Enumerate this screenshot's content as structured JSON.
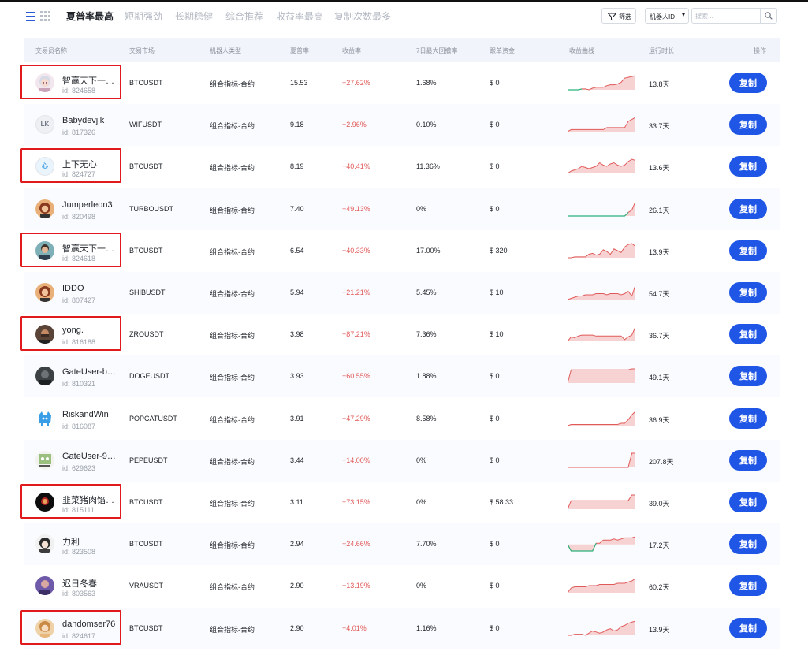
{
  "tabs": [
    {
      "label": "夏普率最高",
      "active": true
    },
    {
      "label": "短期强劲",
      "active": false
    },
    {
      "label": "长期稳健",
      "active": false
    },
    {
      "label": "综合推荐",
      "active": false
    },
    {
      "label": "收益率最高",
      "active": false
    },
    {
      "label": "复制次数最多",
      "active": false
    }
  ],
  "toolbar": {
    "filter_label": "筛选",
    "id_select_label": "机器人ID",
    "search_placeholder": "搜索..."
  },
  "table": {
    "headers": {
      "trader": "交易员名称",
      "market": "交易市场",
      "robot_type": "机器人类型",
      "sharpe": "夏普率",
      "return": "收益率",
      "max_drawdown": "7日最大回撤率",
      "followers_fund": "跟单资金",
      "curve": "收益曲线",
      "runtime": "运行时长",
      "action": "操作"
    },
    "copy_label": "复制",
    "rows": [
      {
        "name": "智赢天下一…",
        "id": "id: 824658",
        "market": "BTCUSDT",
        "robot_type": "组合指标-合约",
        "sharpe": "15.53",
        "return": "+27.62%",
        "drawdown": "1.68%",
        "fund": "$ 0",
        "runtime": "13.8天",
        "curve": [
          0,
          0,
          0,
          0,
          1,
          1,
          0,
          2,
          3,
          3,
          3,
          5,
          6,
          6,
          7,
          9,
          14,
          15,
          16,
          17
        ],
        "curve_start_color": "#2bb37b",
        "avatar": "anime",
        "highlighted": true
      },
      {
        "name": "Babydevjlk",
        "id": "id: 817326",
        "market": "WIFUSDT",
        "robot_type": "组合指标-合约",
        "sharpe": "9.18",
        "return": "+2.96%",
        "drawdown": "0.10%",
        "fund": "$ 0",
        "runtime": "33.7天",
        "curve": [
          0,
          1,
          1,
          1,
          1,
          1,
          1,
          1,
          1,
          1,
          1,
          2,
          2,
          2,
          2,
          2,
          2,
          5,
          6,
          7
        ],
        "curve_start_color": "#e15a5a",
        "avatar": "LK",
        "highlighted": false
      },
      {
        "name": "上下无心",
        "id": "id: 824727",
        "market": "BTCUSDT",
        "robot_type": "组合指标-合约",
        "sharpe": "8.19",
        "return": "+40.41%",
        "drawdown": "11.36%",
        "fund": "$ 0",
        "runtime": "13.6天",
        "curve": [
          0,
          2,
          3,
          4,
          6,
          5,
          4,
          5,
          6,
          9,
          7,
          6,
          8,
          9,
          7,
          6,
          7,
          10,
          12,
          11
        ],
        "curve_start_color": "#e15a5a",
        "avatar": "心",
        "highlighted": true
      },
      {
        "name": "Jumperleon3",
        "id": "id: 820498",
        "market": "TURBOUSDT",
        "robot_type": "组合指标-合约",
        "sharpe": "7.40",
        "return": "+49.13%",
        "drawdown": "0%",
        "fund": "$ 0",
        "runtime": "26.1天",
        "curve": [
          0,
          0,
          0,
          0,
          0,
          0,
          0,
          0,
          0,
          0,
          0,
          0,
          0,
          0,
          0,
          0,
          0,
          3,
          5,
          12
        ],
        "curve_start_color": "#2bb37b",
        "avatar": "woman",
        "highlighted": false
      },
      {
        "name": "智赢天下一…",
        "id": "id: 824618",
        "market": "BTCUSDT",
        "robot_type": "组合指标-合约",
        "sharpe": "6.54",
        "return": "+40.33%",
        "drawdown": "17.00%",
        "fund": "$ 320",
        "runtime": "13.9天",
        "curve": [
          0,
          0,
          1,
          1,
          1,
          1,
          4,
          5,
          3,
          4,
          9,
          7,
          4,
          10,
          8,
          6,
          12,
          15,
          16,
          13
        ],
        "curve_start_color": "#e15a5a",
        "avatar": "man",
        "highlighted": true
      },
      {
        "name": "IDDO",
        "id": "id: 807427",
        "market": "SHIBUSDT",
        "robot_type": "组合指标-合约",
        "sharpe": "5.94",
        "return": "+21.21%",
        "drawdown": "5.45%",
        "fund": "$ 10",
        "runtime": "54.7天",
        "curve": [
          0,
          1,
          2,
          3,
          3,
          4,
          4,
          4,
          5,
          5,
          5,
          4,
          5,
          5,
          5,
          4,
          5,
          7,
          3,
          12
        ],
        "curve_start_color": "#e15a5a",
        "avatar": "woman",
        "highlighted": false
      },
      {
        "name": "yong.",
        "id": "id: 816188",
        "market": "ZROUSDT",
        "robot_type": "组合指标-合约",
        "sharpe": "3.98",
        "return": "+87.21%",
        "drawdown": "7.36%",
        "fund": "$ 10",
        "runtime": "36.7天",
        "curve": [
          0,
          5,
          4,
          6,
          7,
          7,
          7,
          7,
          6,
          6,
          6,
          6,
          6,
          6,
          6,
          6,
          2,
          5,
          7,
          16
        ],
        "curve_start_color": "#e15a5a",
        "avatar": "man2",
        "highlighted": true
      },
      {
        "name": "GateUser-b…",
        "id": "id: 810321",
        "market": "DOGEUSDT",
        "robot_type": "组合指标-合约",
        "sharpe": "3.93",
        "return": "+60.55%",
        "drawdown": "1.88%",
        "fund": "$ 0",
        "runtime": "49.1天",
        "curve": [
          0,
          14,
          14,
          14,
          14,
          14,
          14,
          14,
          14,
          14,
          14,
          14,
          14,
          14,
          14,
          14,
          14,
          14,
          15,
          15
        ],
        "curve_start_color": "#e15a5a",
        "avatar": "dark",
        "highlighted": false
      },
      {
        "name": "RiskandWin",
        "id": "id: 816087",
        "market": "POPCATUSDT",
        "robot_type": "组合指标-合约",
        "sharpe": "3.91",
        "return": "+47.29%",
        "drawdown": "8.58%",
        "fund": "$ 0",
        "runtime": "36.9天",
        "curve": [
          0,
          1,
          1,
          1,
          1,
          1,
          1,
          1,
          1,
          1,
          1,
          1,
          1,
          1,
          1,
          2,
          2,
          5,
          9,
          12
        ],
        "curve_start_color": "#e15a5a",
        "avatar": "mascot",
        "highlighted": false
      },
      {
        "name": "GateUser-9…",
        "id": "id: 629623",
        "market": "PEPEUSDT",
        "robot_type": "组合指标-合约",
        "sharpe": "3.44",
        "return": "+14.00%",
        "drawdown": "0%",
        "fund": "$ 0",
        "runtime": "207.8天",
        "curve": [
          0,
          0,
          0,
          0,
          0,
          0,
          0,
          0,
          0,
          0,
          0,
          0,
          0,
          0,
          0,
          0,
          0,
          0,
          16,
          16
        ],
        "curve_start_color": "#e15a5a",
        "avatar": "frog",
        "highlighted": false
      },
      {
        "name": "韭菜猪肉馅…",
        "id": "id: 815111",
        "market": "BTCUSDT",
        "robot_type": "组合指标-合约",
        "sharpe": "3.11",
        "return": "+73.15%",
        "drawdown": "0%",
        "fund": "$ 58.33",
        "runtime": "39.0天",
        "curve": [
          0,
          6,
          6,
          6,
          6,
          6,
          6,
          6,
          6,
          6,
          6,
          6,
          6,
          6,
          6,
          6,
          6,
          6,
          10,
          10
        ],
        "curve_start_color": "#e15a5a",
        "avatar": "dark2",
        "highlighted": true
      },
      {
        "name": "力利",
        "id": "id: 823508",
        "market": "BTCUSDT",
        "robot_type": "组合指标-合约",
        "sharpe": "2.94",
        "return": "+24.66%",
        "drawdown": "7.70%",
        "fund": "$ 0",
        "runtime": "17.2天",
        "curve": [
          0,
          -6,
          -6,
          -6,
          -6,
          -6,
          -6,
          -6,
          1,
          1,
          4,
          4,
          4,
          5,
          4,
          5,
          6,
          6,
          6,
          7
        ],
        "curve_start_color": "#2bb37b",
        "avatar": "anime2",
        "highlighted": false
      },
      {
        "name": "迟日冬春",
        "id": "id: 803563",
        "market": "VRAUSDT",
        "robot_type": "组合指标-合约",
        "sharpe": "2.90",
        "return": "+13.19%",
        "drawdown": "0%",
        "fund": "$ 0",
        "runtime": "60.2天",
        "curve": [
          0,
          4,
          5,
          5,
          5,
          5,
          6,
          6,
          6,
          7,
          7,
          7,
          7,
          7,
          8,
          8,
          8,
          9,
          10,
          12
        ],
        "curve_start_color": "#e15a5a",
        "avatar": "purple",
        "highlighted": false
      },
      {
        "name": "dandomser76",
        "id": "id: 824617",
        "market": "BTCUSDT",
        "robot_type": "组合指标-合约",
        "sharpe": "2.90",
        "return": "+4.01%",
        "drawdown": "1.16%",
        "fund": "$ 0",
        "runtime": "13.9天",
        "curve": [
          0,
          0,
          1,
          1,
          1,
          0,
          2,
          4,
          3,
          2,
          3,
          5,
          6,
          4,
          5,
          8,
          9,
          11,
          12,
          13
        ],
        "curve_start_color": "#e15a5a",
        "avatar": "girl",
        "highlighted": true
      }
    ]
  },
  "colors": {
    "accent": "#2056e6",
    "positive_return": "#e15a5a",
    "curve_red": "#e15a5a",
    "curve_green": "#2bb37b",
    "highlight_box": "#e0191d"
  }
}
